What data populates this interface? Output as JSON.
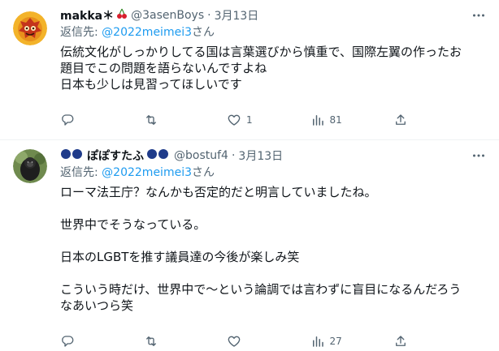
{
  "tweets": [
    {
      "name": "makka＊",
      "handle": "@3asenBoys",
      "date": "3月13日",
      "reply_label": "返信先: ",
      "reply_to": "@2022meimei3",
      "reply_suffix": "さん",
      "text": "伝統文化がしっかりしてる国は言葉選びから慎重で、国際左翼の作ったお\n題目でこの問題を語らないんですよね\n日本も少しは見習ってほしいです",
      "replies": "",
      "retweets": "",
      "likes": "1",
      "views": "81"
    },
    {
      "name": "ぽぽすたふ",
      "handle": "@bostuf4",
      "date": "3月13日",
      "reply_label": "返信先: ",
      "reply_to": "@2022meimei3",
      "reply_suffix": "さん",
      "text": "ローマ法王庁？なんかも否定的だと明言していましたね。\n\n世界中でそうなっている。\n\n日本のLGBTを推す議員達の今後が楽しみ笑\n\nこういう時だけ、世界中で〜という論調では言わずに盲目になるんだろう\nなあいつら笑",
      "replies": "",
      "retweets": "",
      "likes": "",
      "views": "27"
    }
  ],
  "icons": {
    "more": "more-horizontal-icon",
    "reply": "reply-icon",
    "retweet": "retweet-icon",
    "like": "heart-icon",
    "views": "views-bar-chart-icon",
    "share": "share-upload-icon"
  },
  "colors": {
    "link": "#1d9bf0",
    "muted": "#536471",
    "text": "#0f1419"
  }
}
